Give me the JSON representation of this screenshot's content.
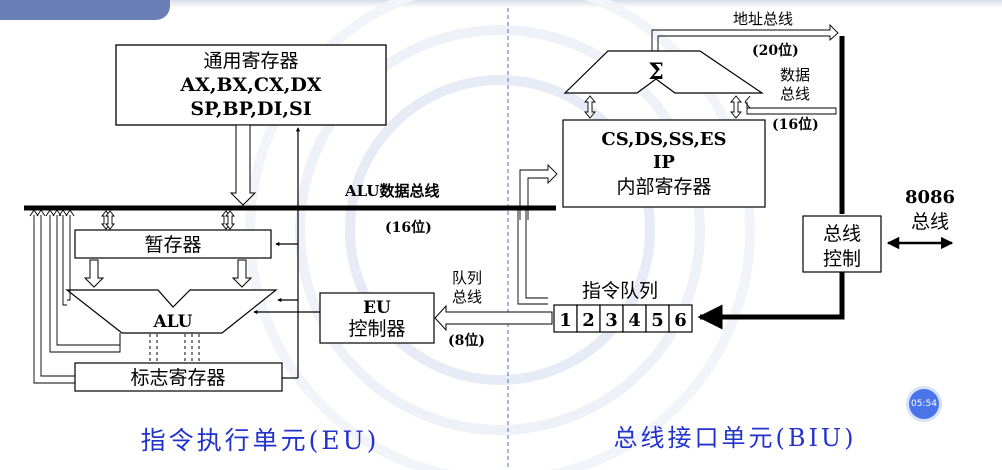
{
  "eu": {
    "title": "指令执行单元(EU)",
    "general_registers": {
      "label": "通用寄存器",
      "line1": "AX,BX,CX,DX",
      "line2": "SP,BP,DI,SI"
    },
    "alu_bus_label": "ALU数据总线",
    "alu_bus_width": "(16位)",
    "temp_register": "暂存器",
    "alu": "ALU",
    "flags_register": "标志寄存器",
    "eu_control": {
      "line1": "EU",
      "line2": "控制器"
    },
    "queue_bus": {
      "line1": "队列",
      "line2": "总线",
      "width": "(8位)"
    }
  },
  "biu": {
    "title": "总线接口单元(BIU)",
    "adder_symbol": "Σ",
    "address_bus": {
      "label": "地址总线",
      "width": "(20位)"
    },
    "data_bus": {
      "line1": "数据",
      "line2": "总线",
      "width": "(16位)"
    },
    "segment_registers": {
      "line1": "CS,DS,SS,ES",
      "line2": "IP",
      "line3": "内部寄存器"
    },
    "bus_control": {
      "line1": "总线",
      "line2": "控制"
    },
    "system_bus": {
      "line1": "8086",
      "line2": "总线"
    },
    "instruction_queue": {
      "label": "指令队列",
      "slots": [
        "1",
        "2",
        "3",
        "4",
        "5",
        "6"
      ]
    }
  },
  "timer": "05:54",
  "colors": {
    "title_blue": "#2233cc",
    "divider": "#6f86c8",
    "ink": "#000000"
  }
}
